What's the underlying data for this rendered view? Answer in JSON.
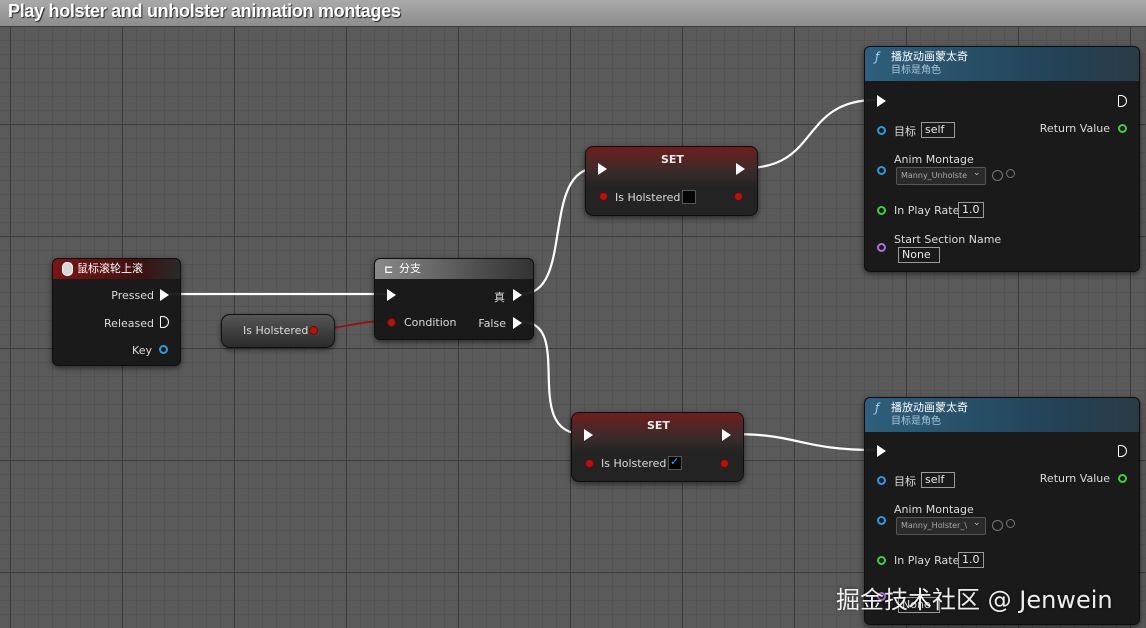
{
  "window": {
    "title": "Play holster and unholster animation montages"
  },
  "event_node": {
    "title": "鼠标滚轮上滚",
    "pins": {
      "pressed": "Pressed",
      "released": "Released",
      "key": "Key"
    }
  },
  "var_node": {
    "label": "Is Holstered"
  },
  "branch_node": {
    "title": "分支",
    "pins": {
      "condition": "Condition",
      "true_label": "真",
      "false_label": "False"
    }
  },
  "set_top": {
    "title": "SET",
    "pin_label": "Is Holstered",
    "checked": false
  },
  "set_bottom": {
    "title": "SET",
    "pin_label": "Is Holstered",
    "checked": true
  },
  "montage_top": {
    "title": "播放动画蒙太奇",
    "subtitle": "目标是角色",
    "target_label": "目标",
    "target_value": "self",
    "return_label": "Return Value",
    "anim_label": "Anim Montage",
    "anim_value": "Manny_Unholste",
    "rate_label": "In Play Rate",
    "rate_value": "1.0",
    "section_label": "Start Section Name",
    "section_value": "None"
  },
  "montage_bottom": {
    "title": "播放动画蒙太奇",
    "subtitle": "目标是角色",
    "target_label": "目标",
    "target_value": "self",
    "return_label": "Return Value",
    "anim_label": "Anim Montage",
    "anim_value": "Manny_Holster_\\",
    "rate_label": "In Play Rate",
    "rate_value": "1.0",
    "section_value": "None"
  },
  "watermark": "掘金技术社区 @ Jenwein",
  "colors": {
    "exec": "#ffffff",
    "bool_pin": "#b0160f",
    "object_pin": "#2d9be0",
    "float_pin": "#3fcf3f",
    "name_pin": "#b46ee0"
  }
}
